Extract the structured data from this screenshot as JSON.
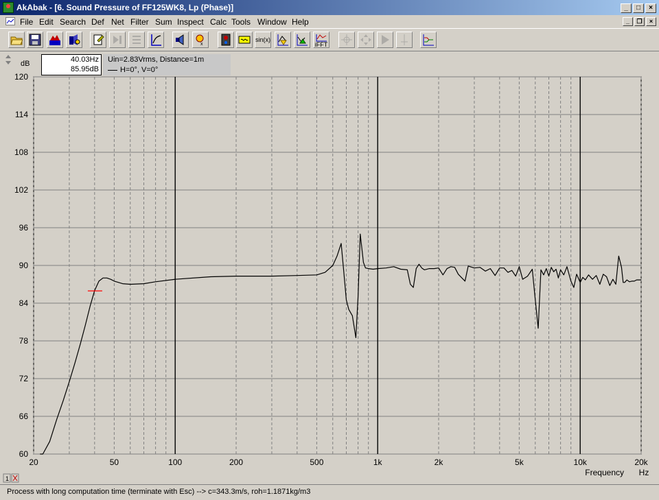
{
  "window": {
    "title": "AkAbak - [6. Sound Pressure of FF125WK8, Lp (Phase)]"
  },
  "menu": [
    "File",
    "Edit",
    "Search",
    "Def",
    "Net",
    "Filter",
    "Sum",
    "Inspect",
    "Calc",
    "Tools",
    "Window",
    "Help"
  ],
  "toolbar": {
    "buttons": [
      {
        "name": "open-icon"
      },
      {
        "name": "save-icon"
      },
      {
        "name": "model-icon"
      },
      {
        "name": "driver-icon"
      },
      {
        "name": "edit-icon"
      },
      {
        "name": "step-icon"
      },
      {
        "name": "list-icon"
      },
      {
        "name": "scale-icon"
      },
      {
        "name": "speaker-icon"
      },
      {
        "name": "xy-icon"
      },
      {
        "name": "box-icon"
      },
      {
        "name": "filter-icon"
      },
      {
        "name": "sin-button",
        "label": "sin(x)"
      },
      {
        "name": "plot-up-icon"
      },
      {
        "name": "plot-down-icon"
      },
      {
        "name": "ifft-button",
        "label": "iFFT"
      },
      {
        "name": "cursor-icon"
      },
      {
        "name": "move-icon"
      },
      {
        "name": "play-icon"
      },
      {
        "name": "marker-icon"
      },
      {
        "name": "graphs-icon"
      }
    ]
  },
  "cursor": {
    "freq": "40.03Hz",
    "level": "85.95dB"
  },
  "info": {
    "line1": "Uin=2.83Vrms, Distance=1m",
    "line2": "H=0°, V=0°"
  },
  "status": {
    "text": "Process with long computation time (terminate with Esc) --> c=343.3m/s, roh=1.1871kg/m3"
  },
  "colors": {
    "title_start": "#0a246a",
    "title_end": "#a6caf0",
    "curve": "#000000",
    "cursor_mark": "#ff0000"
  },
  "chart_data": {
    "type": "line",
    "title": "",
    "xlabel": "Frequency",
    "xunit": "Hz",
    "ylabel": "dB",
    "xscale": "log",
    "xlim": [
      20,
      20000
    ],
    "ylim": [
      60,
      120
    ],
    "yticks": [
      60,
      66,
      72,
      78,
      84,
      90,
      96,
      102,
      108,
      114,
      120
    ],
    "xtick_labels": [
      {
        "v": 20,
        "t": "20"
      },
      {
        "v": 50,
        "t": "50"
      },
      {
        "v": 100,
        "t": "100"
      },
      {
        "v": 200,
        "t": "200"
      },
      {
        "v": 500,
        "t": "500"
      },
      {
        "v": 1000,
        "t": "1k"
      },
      {
        "v": 2000,
        "t": "2k"
      },
      {
        "v": 5000,
        "t": "5k"
      },
      {
        "v": 10000,
        "t": "10k"
      },
      {
        "v": 20000,
        "t": "20k"
      }
    ],
    "grid": true,
    "cursor_marker": {
      "x": 40.03,
      "y": 85.95
    },
    "series": [
      {
        "x": [
          21.5,
          22.2,
          24,
          26,
          28,
          30,
          32,
          34,
          36,
          38,
          40,
          42,
          44,
          46,
          48,
          50,
          55,
          60,
          70,
          80,
          100,
          150,
          200,
          300,
          400,
          500,
          550,
          600,
          630,
          660,
          680,
          700,
          720,
          750,
          780,
          800,
          820,
          850,
          870,
          900,
          950,
          1000,
          1100,
          1200,
          1300,
          1400,
          1450,
          1500,
          1550,
          1600,
          1650,
          1700,
          1800,
          1900,
          2000,
          2100,
          2200,
          2300,
          2400,
          2500,
          2700,
          2800,
          3000,
          3200,
          3400,
          3600,
          3800,
          4000,
          4200,
          4400,
          4600,
          4800,
          5000,
          5200,
          5500,
          5800,
          6000,
          6200,
          6400,
          6600,
          6800,
          7000,
          7200,
          7400,
          7600,
          7800,
          8000,
          8300,
          8600,
          9000,
          9300,
          9600,
          10000,
          10300,
          10600,
          11000,
          11500,
          12000,
          12500,
          13000,
          13500,
          14000,
          14500,
          15000,
          15500,
          16000,
          16300,
          16600,
          17000,
          17500,
          18000,
          18500,
          19000,
          20000
        ],
        "y": [
          60,
          60,
          62,
          65.5,
          68.5,
          71.5,
          74.5,
          77.5,
          80.5,
          83.5,
          86,
          87.5,
          88,
          88,
          87.8,
          87.5,
          87.1,
          87,
          87.1,
          87.4,
          87.8,
          88.2,
          88.3,
          88.3,
          88.4,
          88.5,
          88.9,
          90,
          91.5,
          93.5,
          89,
          84.5,
          83,
          82,
          78.5,
          85,
          95,
          90.5,
          89.6,
          89.5,
          89.4,
          89.5,
          89.6,
          89.8,
          89.4,
          89.3,
          87,
          86.5,
          89.5,
          90.2,
          89.6,
          89.3,
          89.5,
          89.5,
          89.6,
          88.5,
          89.5,
          89.8,
          89.7,
          88.6,
          87.5,
          89.9,
          89.6,
          89.7,
          89.1,
          89.5,
          88.4,
          89.6,
          89.6,
          88.9,
          89.2,
          88.3,
          89.8,
          87.8,
          88.3,
          89.4,
          84.5,
          80,
          89.3,
          88.5,
          89.5,
          88.3,
          89.7,
          89,
          89.4,
          88,
          89.3,
          88.5,
          89.8,
          87.5,
          86.5,
          88.6,
          87.3,
          88.1,
          87.7,
          88.5,
          87.8,
          88.4,
          87,
          88.6,
          88.2,
          86.8,
          87.8,
          87,
          91.5,
          89.7,
          87.3,
          87.3,
          87.7,
          87.4,
          87.5,
          87.5,
          87.7,
          87.7
        ]
      }
    ]
  }
}
